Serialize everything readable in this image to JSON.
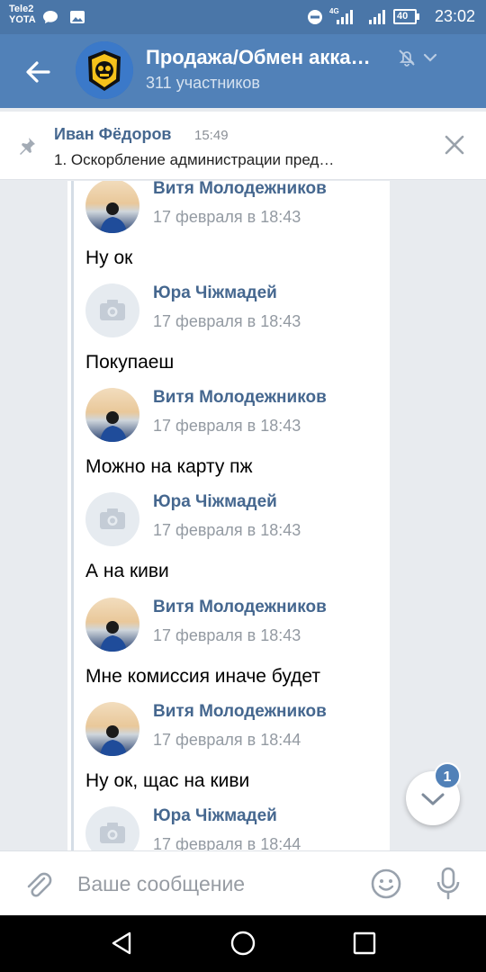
{
  "status_bar": {
    "carrier_line1": "Tele2",
    "carrier_line2": "YOTA",
    "network": "4G",
    "battery": "40",
    "time": "23:02"
  },
  "header": {
    "title": "Продажа/Обмен акка…",
    "subtitle": "311 участников"
  },
  "pinned": {
    "author": "Иван Фёдоров",
    "time": "15:49",
    "text": "1. Оскорбление администрации пред…"
  },
  "messages": [
    {
      "author": "Витя Молодежников",
      "date": "17 февраля в 18:43",
      "text": "Ну ок",
      "avatar": "photo"
    },
    {
      "author": "Юра Чіжмадей",
      "date": "17 февраля в 18:43",
      "text": "Покупаеш",
      "avatar": "empty"
    },
    {
      "author": "Витя Молодежников",
      "date": "17 февраля в 18:43",
      "text": "Можно на карту пж",
      "avatar": "photo"
    },
    {
      "author": "Юра Чіжмадей",
      "date": "17 февраля в 18:43",
      "text": "А на киви",
      "avatar": "empty"
    },
    {
      "author": "Витя Молодежников",
      "date": "17 февраля в 18:43",
      "text": "Мне комиссия иначе будет",
      "avatar": "photo"
    },
    {
      "author": "Витя Молодежников",
      "date": "17 февраля в 18:44",
      "text": "Ну ок, щас на киви",
      "avatar": "photo"
    },
    {
      "author": "Юра Чіжмадей",
      "date": "17 февраля в 18:44",
      "text": "",
      "avatar": "empty"
    }
  ],
  "scroll_down": {
    "badge": "1"
  },
  "composer": {
    "placeholder": "Ваше сообщение"
  },
  "icons": {
    "back": "arrow-left-icon",
    "mute": "bell-off-icon",
    "menu": "chevron-down-icon",
    "pin": "pin-icon",
    "close": "close-icon",
    "attach": "paperclip-icon",
    "emoji": "smile-icon",
    "mic": "microphone-icon"
  },
  "colors": {
    "header": "#5181b8",
    "status_bar": "#4a76a8",
    "author_link": "#45678f",
    "background": "#e8ebef"
  }
}
